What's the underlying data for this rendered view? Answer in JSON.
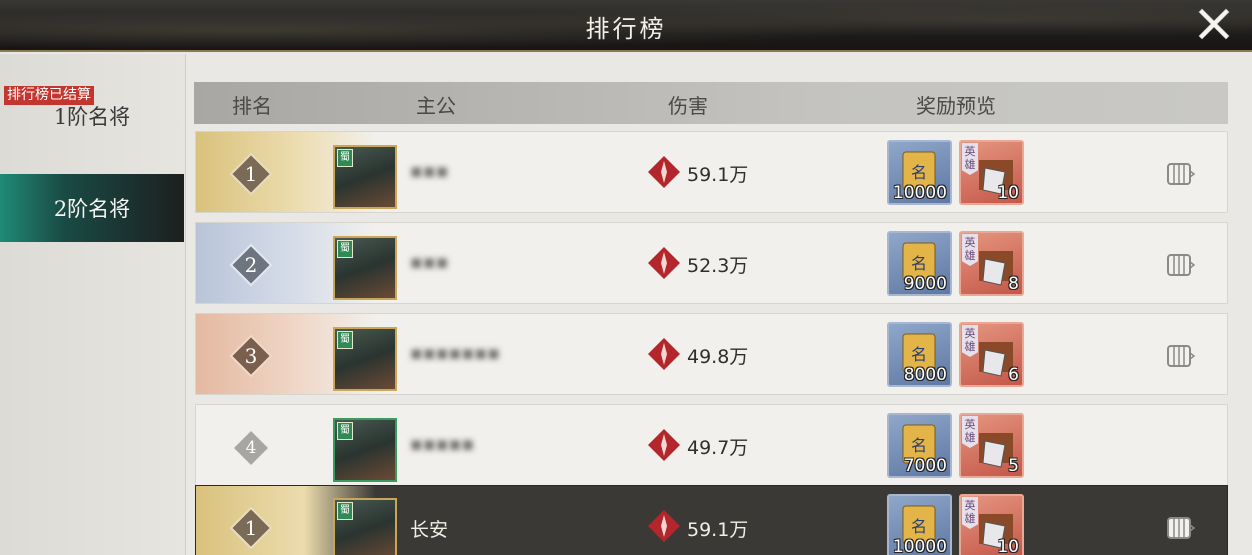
{
  "header": {
    "title": "排行榜"
  },
  "sidebar": {
    "ended_badge": "排行榜已结算",
    "tabs": [
      {
        "label": "1阶名将",
        "active": false
      },
      {
        "label": "2阶名将",
        "active": true
      }
    ]
  },
  "columns": {
    "rank": "排名",
    "lord": "主公",
    "damage": "伤害",
    "reward": "奖励预览"
  },
  "rows": [
    {
      "rank": "1",
      "name": "▪▪▪",
      "damage": "59.1万",
      "reward_book": "10000",
      "reward_box": "10",
      "hero_tag": "英雄"
    },
    {
      "rank": "2",
      "name": "▪▪▪",
      "damage": "52.3万",
      "reward_book": "9000",
      "reward_box": "8",
      "hero_tag": "英雄"
    },
    {
      "rank": "3",
      "name": "▪▪▪▪▪▪▪",
      "damage": "49.8万",
      "reward_book": "8000",
      "reward_box": "6",
      "hero_tag": "英雄"
    },
    {
      "rank": "4",
      "name": "▪▪▪▪▪",
      "damage": "49.7万",
      "reward_book": "7000",
      "reward_box": "5",
      "hero_tag": "英雄"
    }
  ],
  "my_row": {
    "rank": "1",
    "name": "长安",
    "damage": "59.1万",
    "reward_book": "10000",
    "reward_box": "10",
    "hero_tag": "英雄"
  },
  "avatar_tag": "蜀",
  "book_glyph": "名",
  "colors": {
    "accent_teal": "#1f8a77",
    "badge_red": "#c2362f",
    "damage_red": "#b3262b"
  }
}
